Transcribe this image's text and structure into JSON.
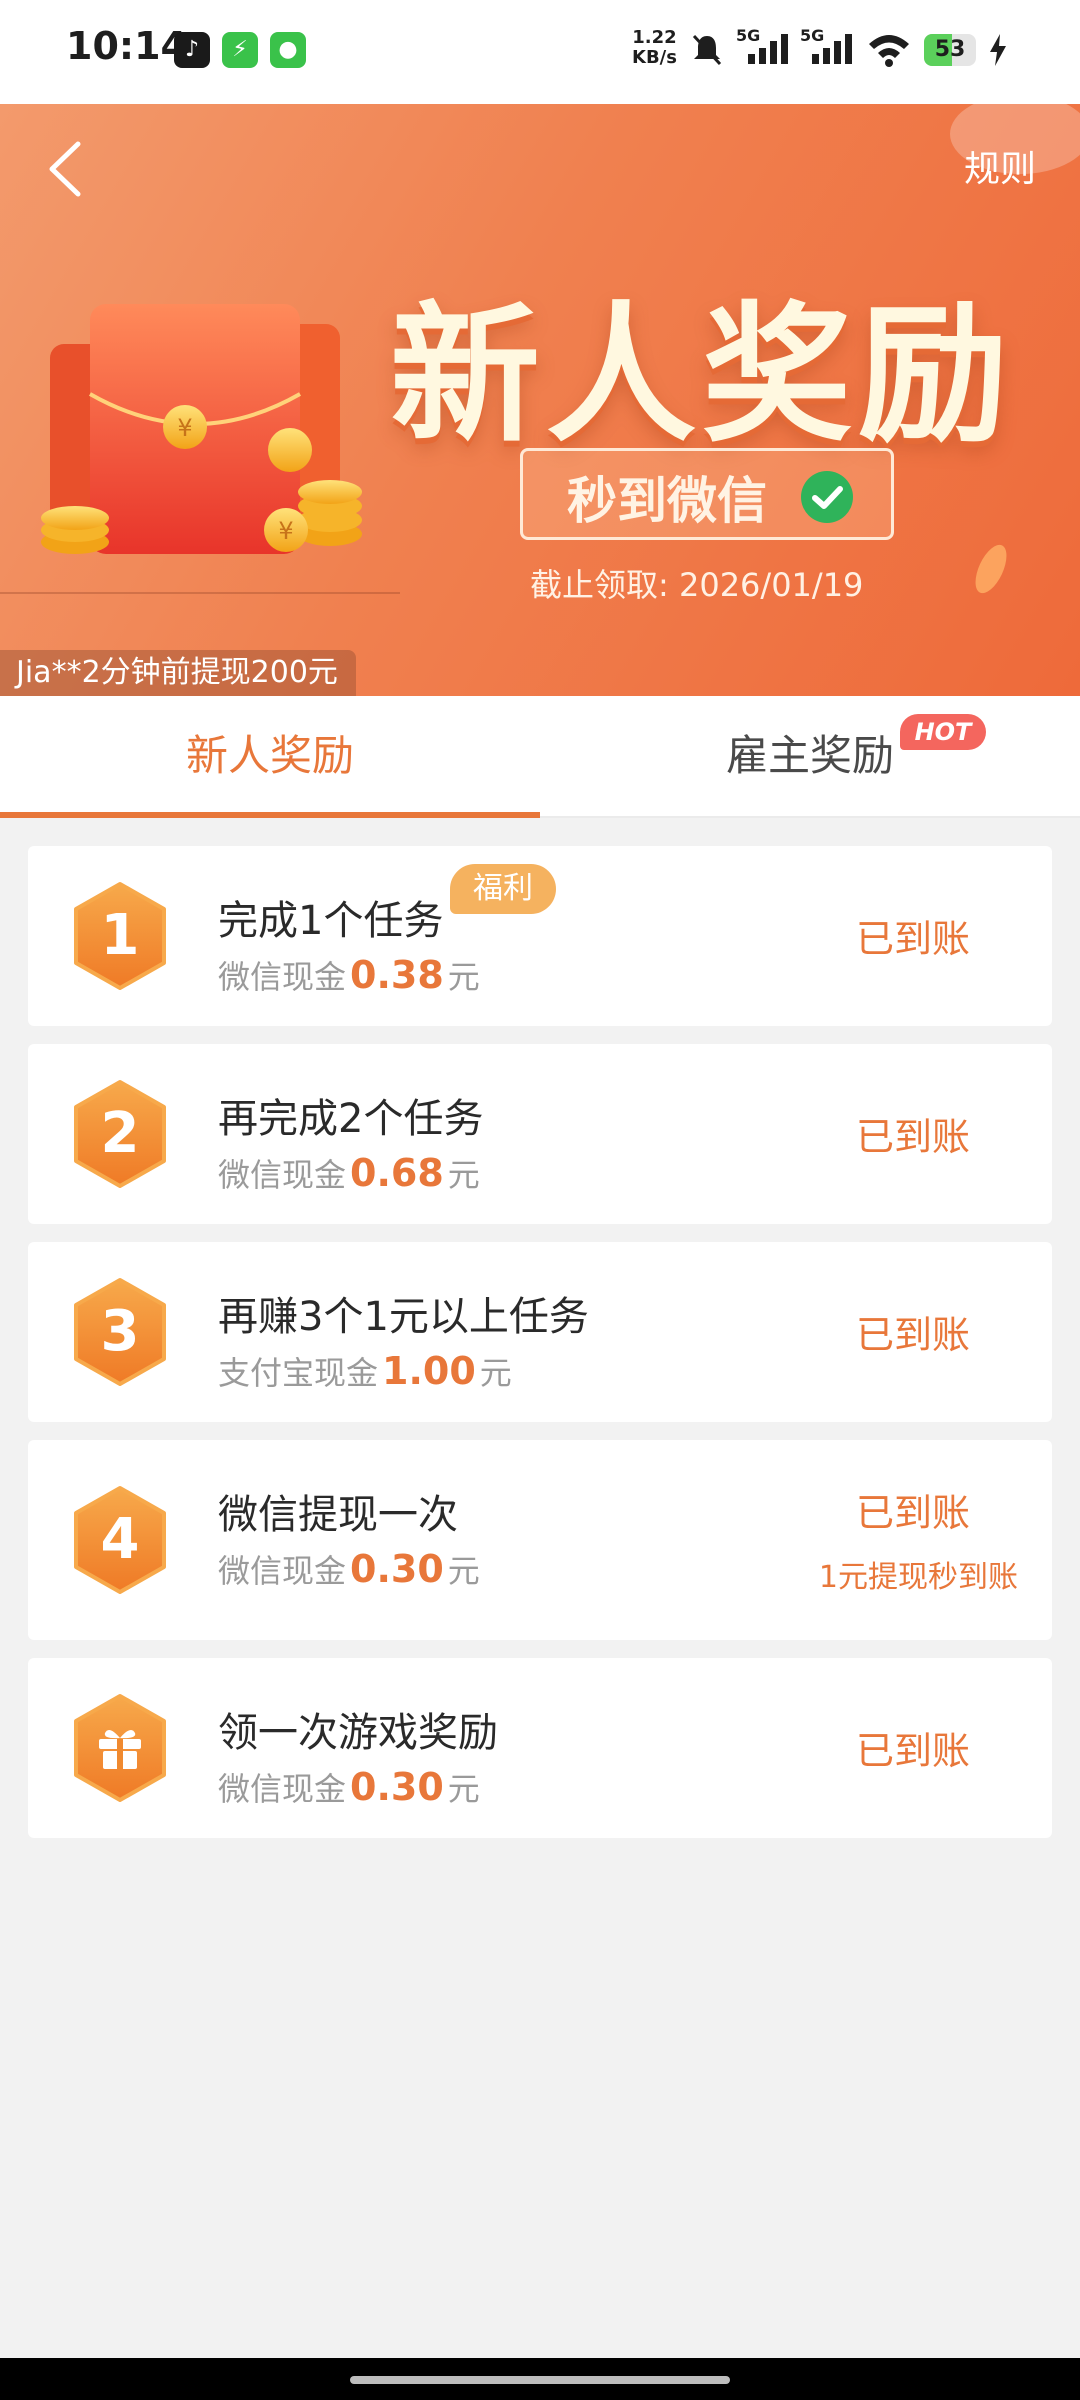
{
  "status_bar": {
    "time": "10:14",
    "net_speed_value": "1.22",
    "net_speed_unit": "KB/s",
    "network_1": "5G",
    "network_2": "5G",
    "battery": "53",
    "battery_level": 0.53
  },
  "header": {
    "rules_label": "规则",
    "title": "新人奖励",
    "pill_text": "秒到微信",
    "deadline_label": "截止领取: ",
    "deadline_date": "2026/01/19",
    "ticker": "Jia**2分钟前提现200元"
  },
  "tabs": [
    {
      "label": "新人奖励",
      "active": true
    },
    {
      "label": "雇主奖励",
      "badge": "HOT"
    }
  ],
  "tasks": [
    {
      "step": "1",
      "title": "完成1个任务",
      "badge": "福利",
      "reward_label": "微信现金",
      "amount": "0.38",
      "unit": "元",
      "status": "已到账"
    },
    {
      "step": "2",
      "title": "再完成2个任务",
      "reward_label": "微信现金",
      "amount": "0.68",
      "unit": "元",
      "status": "已到账"
    },
    {
      "step": "3",
      "title": "再赚3个1元以上任务",
      "reward_label": "支付宝现金",
      "amount": "1.00",
      "unit": "元",
      "status": "已到账"
    },
    {
      "step": "4",
      "title": "微信提现一次",
      "reward_label": "微信现金",
      "amount": "0.30",
      "unit": "元",
      "status": "已到账",
      "note": "1元提现秒到账"
    },
    {
      "step": "gift-icon",
      "title": "领一次游戏奖励",
      "reward_label": "微信现金",
      "amount": "0.30",
      "unit": "元",
      "status": "已到账"
    }
  ],
  "colors": {
    "accent": "#e8773a",
    "banner_start": "#f39a6c",
    "banner_end": "#ee6a3a",
    "hot": "#f4665e",
    "badge": "#f5b25f"
  }
}
